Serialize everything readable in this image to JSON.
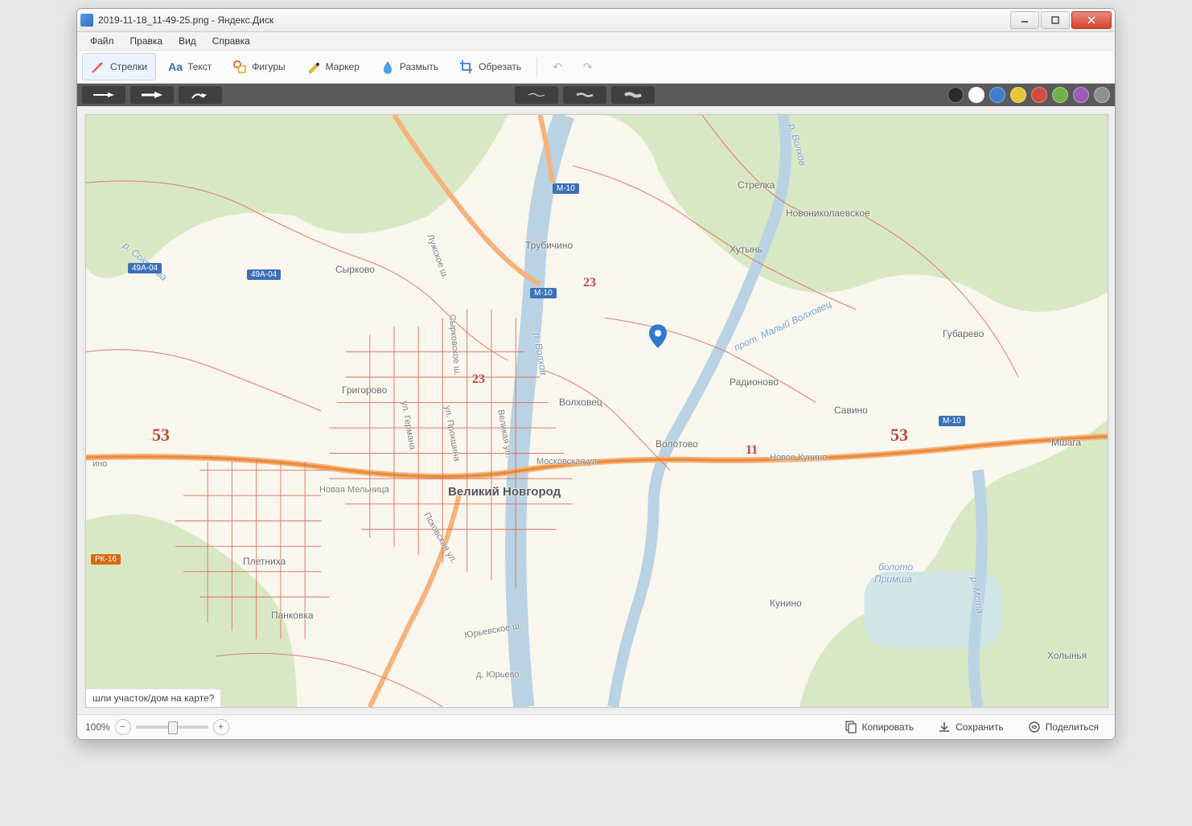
{
  "window": {
    "title": "2019-11-18_11-49-25.png - Яндекс.Диск"
  },
  "menu": {
    "file": "Файл",
    "edit": "Правка",
    "view": "Вид",
    "help": "Справка"
  },
  "tools": {
    "arrows": "Стрелки",
    "text": "Текст",
    "shapes": "Фигуры",
    "marker": "Маркер",
    "blur": "Размыть",
    "crop": "Обрезать"
  },
  "colors": {
    "black": "#2c2c2c",
    "white": "#ffffff",
    "blue": "#3d7ecf",
    "yellow": "#e7c63b",
    "red": "#d34b3d",
    "green": "#6fb24a",
    "purple": "#9a5fb5",
    "gray": "#8f8f8f"
  },
  "map": {
    "labels": {
      "syrkovo": "Сырково",
      "grigorovo": "Григорово",
      "trubichino": "Трубичино",
      "strelka": "Стрелка",
      "novonikolaevskoe": "Новониколаевское",
      "khutyn": "Хутынь",
      "gubarevo": "Губарево",
      "radionovo": "Радионово",
      "savino": "Савино",
      "volotovo": "Волотово",
      "novoe_kunino": "Новое Кунино",
      "mshaga": "Мшага",
      "kunino": "Кунино",
      "kholynya": "Холынья",
      "boloto_primsha_1": "болото",
      "boloto_primsha_2": "Примша",
      "pletniha": "Плетниха",
      "pankovka": "Панковка",
      "novaya_melnitsa": "Новая Мельница",
      "yurevo": "д. Юрьево",
      "velikiy_novgorod": "Великий Новгород",
      "volhovets": "Волховец",
      "r_sokorova": "р. Сокорова",
      "r_volhov": "р. Волхов",
      "r_volhov2": "р. Волхов",
      "r_msta": "р. Мста",
      "prot_malyy_volhovets": "прот. Малый Волховец",
      "moskovskaya": "Московская ул.",
      "syrkovskoe_sh": "Сырковское ш.",
      "luzhskoe_sh": "Лужское ш.",
      "ul_germana": "ул. Германа",
      "ul_prokshina": "ул. Прокшина",
      "velikaya_ul": "Великая ул.",
      "pskovskaya": "Псковская ул.",
      "yurievskoe_sh": "Юрьевское ш.",
      "ino": "ино"
    },
    "routes": {
      "r53": "53",
      "r23": "23",
      "r11": "11"
    },
    "badges": {
      "m10": "М-10",
      "a49": "49А-04",
      "rk16": "РК-16"
    },
    "bottom_caption": "шли участок/дом на карте?"
  },
  "status": {
    "zoom": "100%",
    "copy": "Копировать",
    "save": "Сохранить",
    "share": "Поделиться"
  }
}
